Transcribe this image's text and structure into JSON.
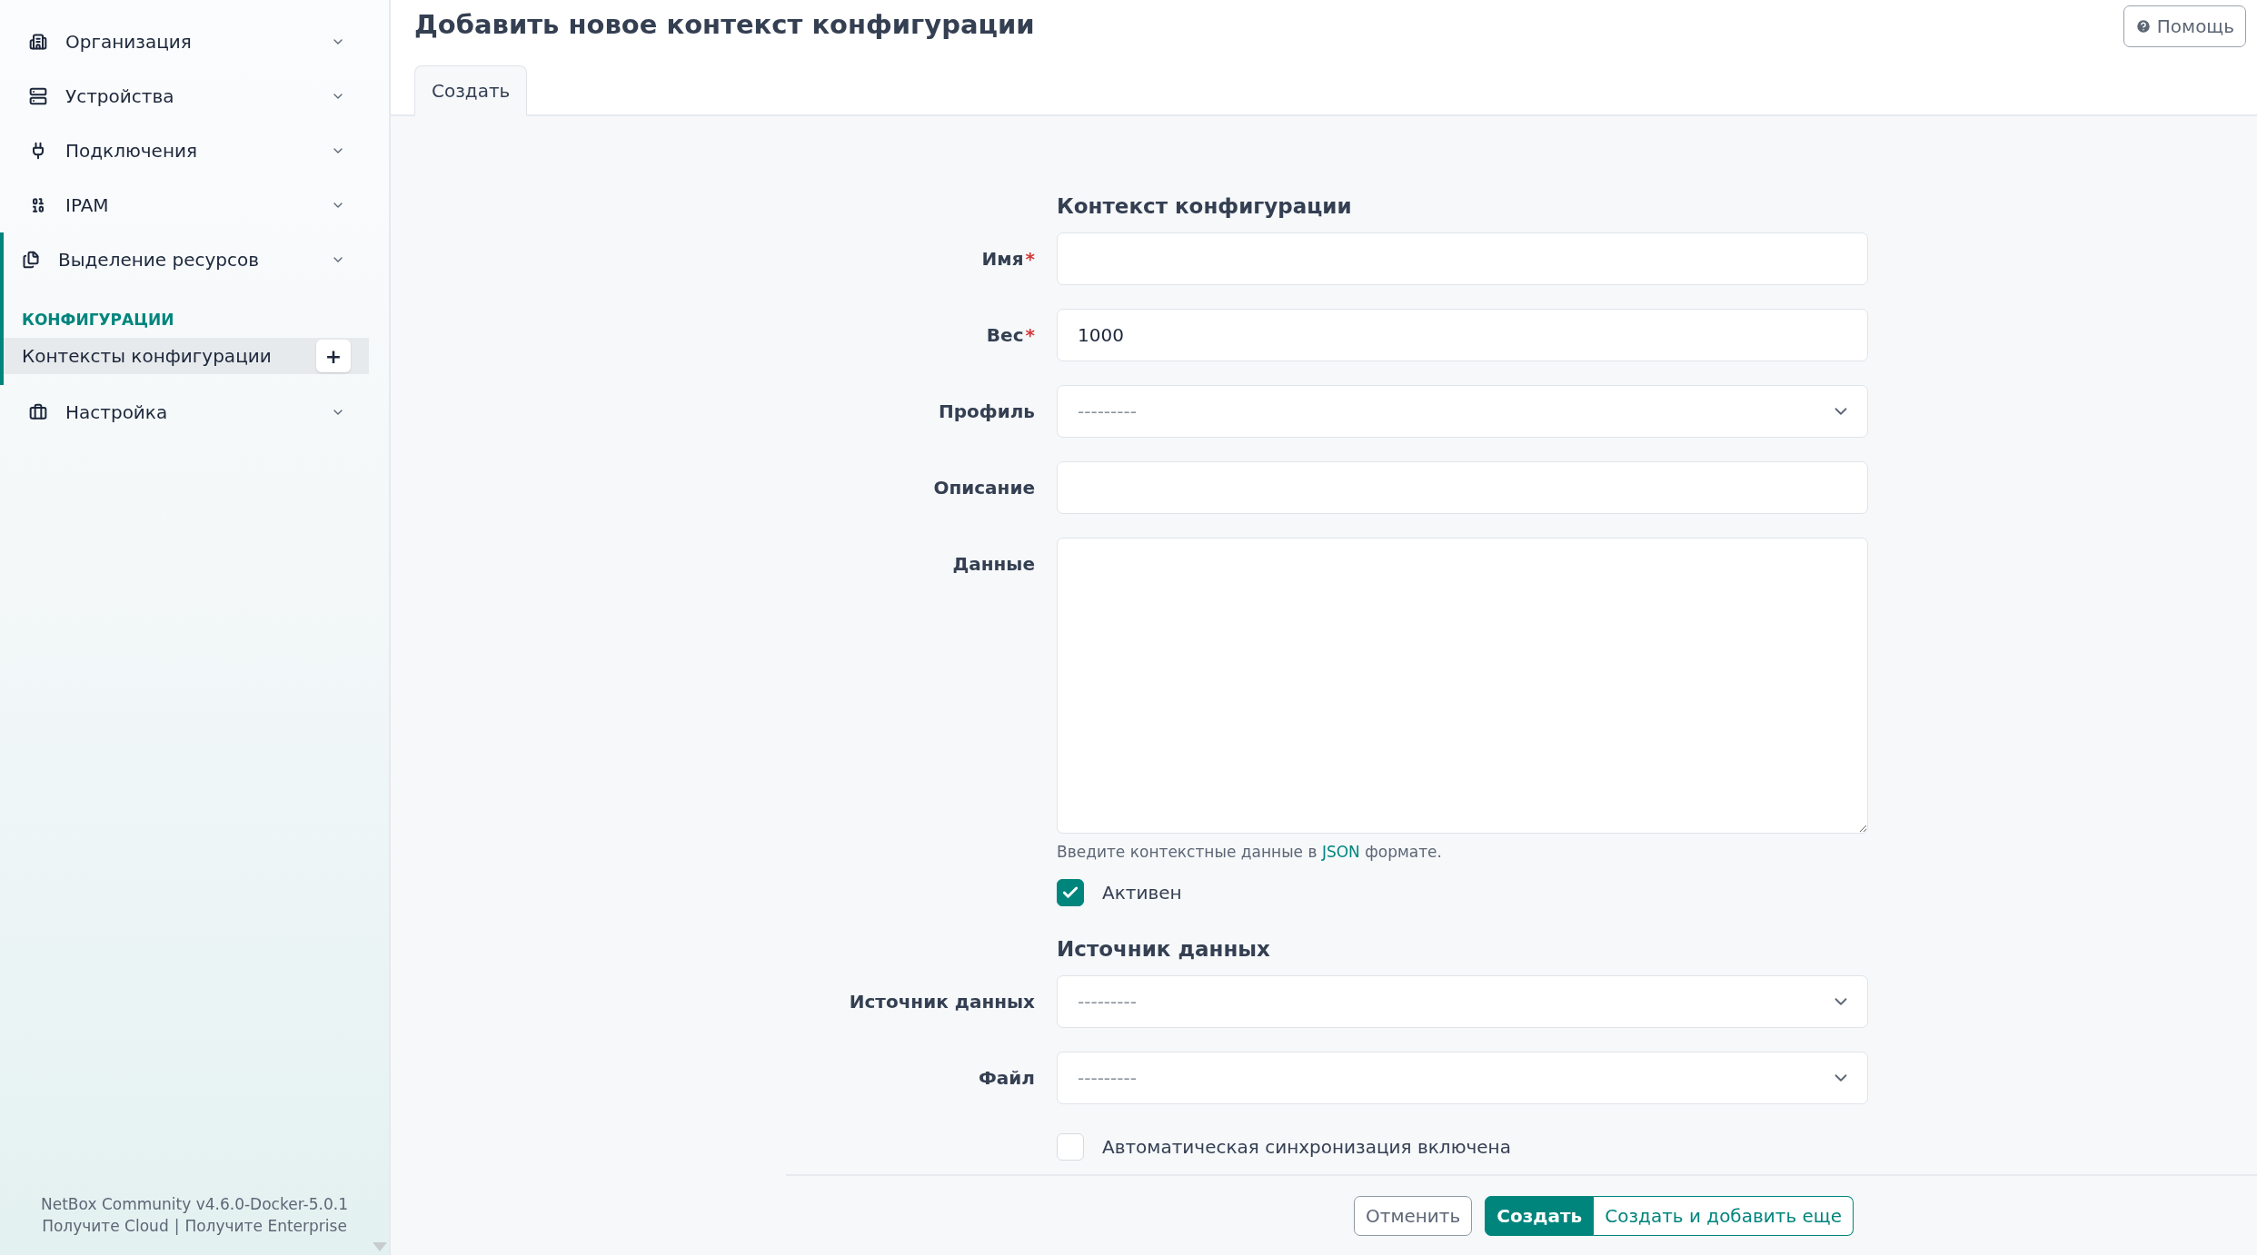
{
  "sidebar": {
    "items": [
      {
        "label": "Организация",
        "expanded": false
      },
      {
        "label": "Устройства",
        "expanded": false
      },
      {
        "label": "Подключения",
        "expanded": false
      },
      {
        "label": "IPAM",
        "expanded": false
      },
      {
        "label": "Выделение ресурсов",
        "expanded": true,
        "children": [
          {
            "kind": "section",
            "label": "КОНФИГУРАЦИИ"
          },
          {
            "kind": "link",
            "label": "Контексты конфигурации",
            "selected": true,
            "add": "+"
          }
        ]
      },
      {
        "label": "Настройка",
        "expanded": false
      }
    ],
    "footer": {
      "version": "NetBox Community v4.6.0-Docker-5.0.1",
      "links": [
        "Получите Cloud",
        "Получите Enterprise"
      ],
      "separator": "|"
    }
  },
  "header": {
    "title": "Добавить новое контекст конфигурации",
    "help": "Помощь"
  },
  "tabs": [
    {
      "label": "Создать",
      "selected": true
    }
  ],
  "required_mark": "*",
  "form": {
    "sections": [
      {
        "title": "Контекст конфигурации",
        "fields": [
          {
            "kind": "text",
            "label": "Имя",
            "required": true
          },
          {
            "kind": "text",
            "label": "Вес",
            "required": true,
            "value": "1000"
          },
          {
            "kind": "select",
            "label": "Профиль",
            "required": false,
            "placeholder": "---------"
          },
          {
            "kind": "text",
            "label": "Описание",
            "required": false
          },
          {
            "kind": "textarea",
            "label": "Данные",
            "required": false,
            "help": {
              "before": "Введите контекстные данные в",
              "link": "JSON",
              "after": "формате."
            }
          },
          {
            "kind": "checkbox",
            "label": "Активен",
            "checked": true
          }
        ]
      },
      {
        "title": "Источник данных",
        "fields": [
          {
            "kind": "select",
            "label": "Источник данных",
            "required": false,
            "placeholder": "---------"
          },
          {
            "kind": "select",
            "label": "Файл",
            "required": false,
            "placeholder": "---------"
          },
          {
            "kind": "checkbox",
            "label": "Автоматическая синхронизация включена",
            "checked": false
          }
        ]
      }
    ]
  },
  "buttons": [
    {
      "kind": "secondary",
      "label": "Отменить"
    },
    {
      "kind": "primary",
      "label": "Создать"
    },
    {
      "kind": "outline",
      "label": "Создать и добавить еще"
    }
  ]
}
